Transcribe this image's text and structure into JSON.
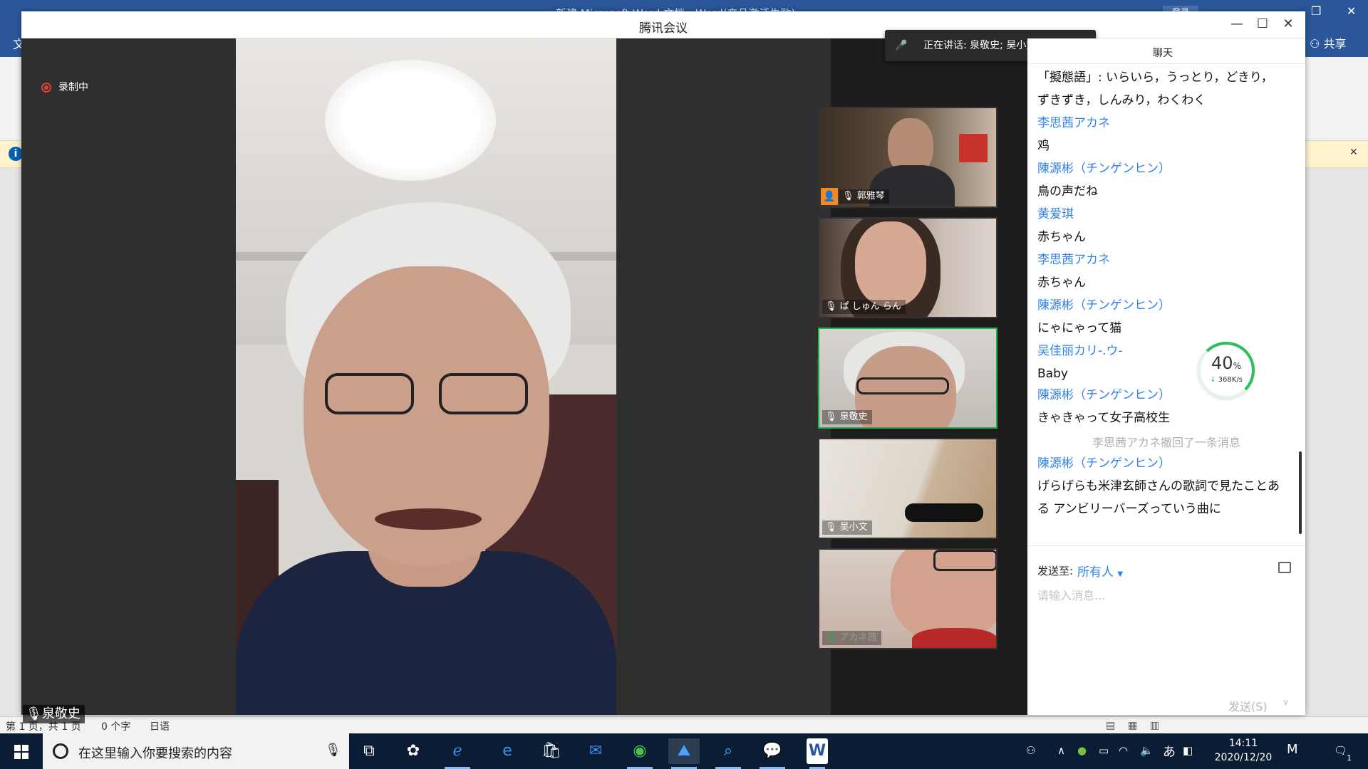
{
  "word": {
    "title": "新建 Microsoft Word 文档 - Word(产品激活失败)",
    "sign_in": "登录",
    "file_tab": "文",
    "share": "共享",
    "status": {
      "page": "第 1 页，共 1 页",
      "words": "0 个字",
      "lang": "日语"
    }
  },
  "meeting": {
    "title": "腾讯会议",
    "recording": "录制中",
    "main_speaker": "泉敬史",
    "speaking_tip": "正在讲话: 泉敬史; 吴小文; 瞿蕾;...",
    "participants": [
      {
        "name": "郭雅琴",
        "host": true
      },
      {
        "name": "ぱ しゅん らん",
        "host": false
      },
      {
        "name": "泉敬史",
        "host": false,
        "active": true
      },
      {
        "name": "吴小文",
        "host": false
      },
      {
        "name": "アカネ茜",
        "host": false
      }
    ],
    "chat": {
      "tab": "聊天",
      "messages": [
        {
          "type": "text",
          "text": "「擬態語」: いらいら，うっとり，どきり，"
        },
        {
          "type": "text",
          "text": "ずきずき，しんみり，わくわく"
        },
        {
          "type": "sender",
          "text": "李思茜アカネ"
        },
        {
          "type": "text",
          "text": "鸡"
        },
        {
          "type": "sender",
          "text": "陳源彬（チンゲンヒン）"
        },
        {
          "type": "text",
          "text": "鳥の声だね"
        },
        {
          "type": "sender",
          "text": "黄爱琪"
        },
        {
          "type": "text",
          "text": "赤ちゃん"
        },
        {
          "type": "sender",
          "text": "李思茜アカネ"
        },
        {
          "type": "text",
          "text": "赤ちゃん"
        },
        {
          "type": "sender",
          "text": "陳源彬（チンゲンヒン）"
        },
        {
          "type": "text",
          "text": "にゃにゃって猫"
        },
        {
          "type": "sender",
          "text": "吴佳丽カリ-.ウ-"
        },
        {
          "type": "text",
          "text": "Baby"
        },
        {
          "type": "sender",
          "text": "陳源彬（チンゲンヒン）"
        },
        {
          "type": "text",
          "text": "きゃきゃって女子高校生"
        },
        {
          "type": "system",
          "text": "李思茜アカネ撤回了一条消息"
        },
        {
          "type": "sender",
          "text": "陳源彬（チンゲンヒン）"
        },
        {
          "type": "text",
          "text": "げらげらも米津玄師さんの歌詞で見たことあ"
        },
        {
          "type": "text",
          "text": "る アンビリーバーズっていう曲に"
        }
      ],
      "send_to_label": "发送至:",
      "send_to_value": "所有人",
      "input_placeholder": "请输入消息...",
      "send_button": "发送(S)"
    },
    "network": {
      "percent": "40",
      "percent_unit": "%",
      "speed": "368K/s"
    }
  },
  "taskbar": {
    "search_placeholder": "在这里输入你要搜索的内容",
    "time": "14:11",
    "date": "2020/12/20",
    "ime": "あ",
    "notifications": "1"
  }
}
